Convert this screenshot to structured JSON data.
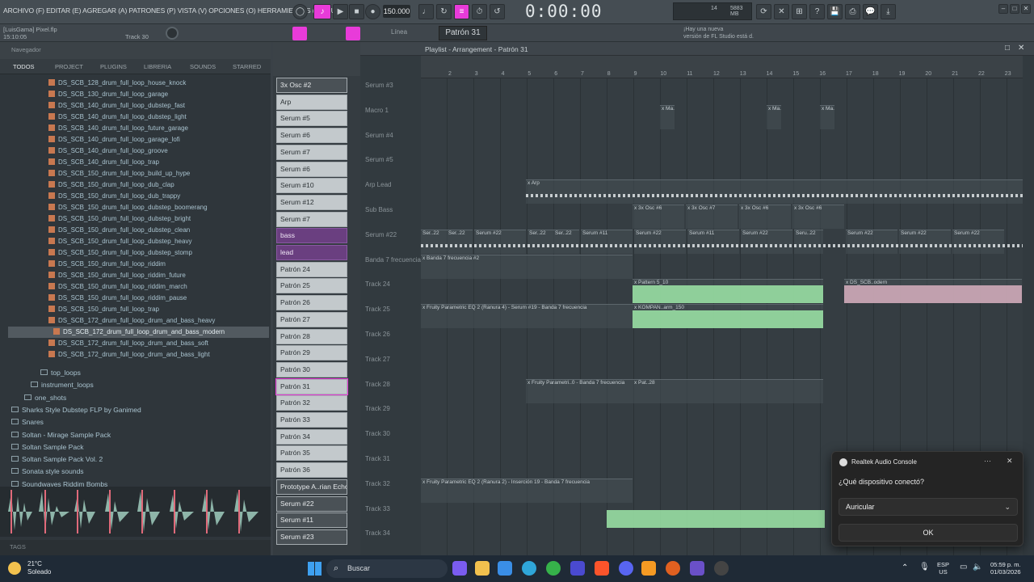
{
  "menu": {
    "text": "ARCHIVO (F) EDITAR (E) AGREGAR (A) PATRONES (P) VISTA (V) OPCIONES (O) HERRAMIENTAS (T) AYUDA"
  },
  "transport": {
    "tempo": "150.000",
    "time": "0:00:00",
    "cpu_value": "5883 MB",
    "cpu_count": "14"
  },
  "status": {
    "project": "[LuisGama] Pixel.flp",
    "time": "15:10:05",
    "track": "Track 30",
    "mode": "Línea",
    "pattern": "Patrón 31",
    "news_line1": "¡Hay una nueva",
    "news_line2": "versión de FL Studio está d."
  },
  "browser": {
    "header": "Navegador",
    "tabs": [
      "TODOS",
      "PROJECT",
      "PLUGINS",
      "LIBRERIA",
      "SOUNDS",
      "STARRED"
    ],
    "files": [
      "DS_SCB_128_drum_full_loop_house_knock",
      "DS_SCB_130_drum_full_loop_garage",
      "DS_SCB_140_drum_full_loop_dubstep_fast",
      "DS_SCB_140_drum_full_loop_dubstep_light",
      "DS_SCB_140_drum_full_loop_future_garage",
      "DS_SCB_140_drum_full_loop_garage_lofi",
      "DS_SCB_140_drum_full_loop_groove",
      "DS_SCB_140_drum_full_loop_trap",
      "DS_SCB_150_drum_full_loop_build_up_hype",
      "DS_SCB_150_drum_full_loop_dub_clap",
      "DS_SCB_150_drum_full_loop_dub_trappy",
      "DS_SCB_150_drum_full_loop_dubstep_boomerang",
      "DS_SCB_150_drum_full_loop_dubstep_bright",
      "DS_SCB_150_drum_full_loop_dubstep_clean",
      "DS_SCB_150_drum_full_loop_dubstep_heavy",
      "DS_SCB_150_drum_full_loop_dubstep_stomp",
      "DS_SCB_150_drum_full_loop_riddim",
      "DS_SCB_150_drum_full_loop_riddim_future",
      "DS_SCB_150_drum_full_loop_riddim_march",
      "DS_SCB_150_drum_full_loop_riddim_pause",
      "DS_SCB_150_drum_full_loop_trap",
      "DS_SCB_172_drum_full_loop_drum_and_bass_heavy",
      "DS_SCB_172_drum_full_loop_drum_and_bass_modern",
      "DS_SCB_172_drum_full_loop_drum_and_bass_soft",
      "DS_SCB_172_drum_full_loop_drum_and_bass_light"
    ],
    "folders": [
      "top_loops",
      "instrument_loops",
      "one_shots",
      "Sharks Style Dubstep FLP by Ganimed",
      "Snares",
      "Soltan - Mirage Sample Pack",
      "Soltan Sample Pack",
      "Soltan Sample Pack Vol. 2",
      "Sonata style sounds",
      "Soundwaves Riddim Bombs"
    ],
    "tags": "TAGS"
  },
  "channels": [
    "3x Osc #2",
    "Arp",
    "Serum #5",
    "Serum #6",
    "Serum #7",
    "Serum #6",
    "Serum #10",
    "Serum #12",
    "Serum #7",
    "bass",
    "lead",
    "Patrón 24",
    "Patrón 25",
    "Patrón 26",
    "Patrón 27",
    "Patrón 28",
    "Patrón 29",
    "Patrón 30",
    "Patrón 31",
    "Patrón 32",
    "Patrón 33",
    "Patrón 34",
    "Patrón 35",
    "Patrón 36",
    "Prototype A..rian Echoes",
    "Serum #22",
    "Serum #11",
    "Serum #23"
  ],
  "playlist": {
    "title": "Playlist - Arrangement - Patrón 31",
    "ruler": [
      "2",
      "3",
      "4",
      "5",
      "6",
      "7",
      "8",
      "9",
      "10",
      "11",
      "12",
      "13",
      "14",
      "15",
      "16",
      "17",
      "18",
      "19",
      "20",
      "21",
      "22",
      "23"
    ],
    "tracks": [
      "Serum #3",
      "Macro 1",
      "Serum #4",
      "Serum #5",
      "Arp Lead",
      "Sub Bass",
      "Serum #22",
      "Banda 7 frecuencia",
      "Track 24",
      "Track 25",
      "Track 26",
      "Track 27",
      "Track 28",
      "Track 29",
      "Track 30",
      "Track 31",
      "Track 32",
      "Track 33",
      "Track 34"
    ],
    "clips": [
      {
        "label": "x Ma..o 1"
      },
      {
        "label": "x Ma..o 1"
      },
      {
        "label": "x Ma..o 1"
      },
      {
        "label": "x Arp"
      },
      {
        "label": "x 3x Osc #6"
      },
      {
        "label": "x 3x Osc #7"
      },
      {
        "label": "x 3x Osc #6"
      },
      {
        "label": "x 3x Osc #6"
      },
      {
        "label": "Ser..22"
      },
      {
        "label": "Ser..22"
      },
      {
        "label": "Serum #22"
      },
      {
        "label": "Ser..22"
      },
      {
        "label": "Ser..22"
      },
      {
        "label": "Serum #11"
      },
      {
        "label": "Serum #22"
      },
      {
        "label": "Serum #11"
      },
      {
        "label": "Serum #22"
      },
      {
        "label": "Seru..22"
      },
      {
        "label": "Serum #22"
      },
      {
        "label": "Serum #22"
      },
      {
        "label": "Serum #22"
      },
      {
        "label": "x Banda 7 frecuencia #2"
      },
      {
        "label": "x Pattern 5_10"
      },
      {
        "label": "x DS_SCB..odern"
      },
      {
        "label": "x Fruity Parametric EQ 2 (Ranura 4) - Serum #19 - Banda 7 frecuencia"
      },
      {
        "label": "x KOMPAN..arm_150"
      },
      {
        "label": "x Fruity Parametri..0 - Banda 7 frecuencia"
      },
      {
        "label": "x Pat..28"
      },
      {
        "label": "x Fruity Parametric EQ 2 (Ranura 2) - Inserción 19 - Banda 7 frecuencia"
      }
    ]
  },
  "dialog": {
    "title": "Realtek Audio Console",
    "question": "¿Qué dispositivo conectó?",
    "selected": "Auricular",
    "ok": "OK",
    "more": "···",
    "close": "✕"
  },
  "taskbar": {
    "temp": "21°C",
    "weather": "Soleado",
    "search": "Buscar",
    "lang1": "ESP",
    "lang2": "US",
    "time": "05:59 p. m.",
    "date": "01/03/2026"
  },
  "colors": {
    "accent": "#e83bd9",
    "audio_clip": "#9ee8a8",
    "dialog_bg": "#242424"
  }
}
